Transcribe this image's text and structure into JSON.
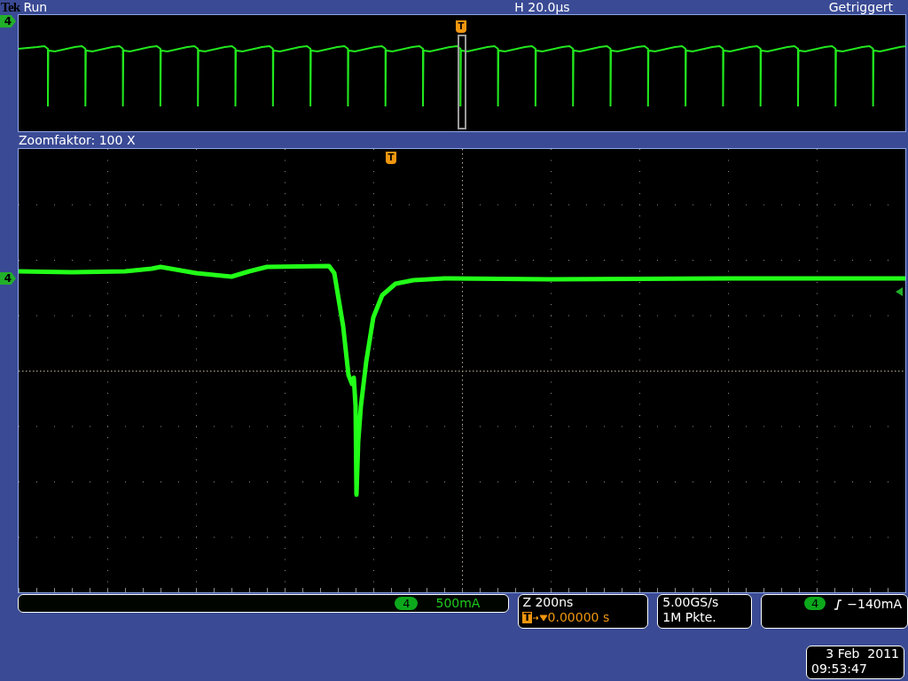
{
  "header": {
    "brand": "Tek",
    "status": "Run",
    "horizontal": "H 20.0µs",
    "trigger_state": "Getriggert"
  },
  "overview": {
    "channel_marker": "4",
    "trigger_marker": "T"
  },
  "zoom_label": "Zoomfaktor: 100 X",
  "main": {
    "channel_marker": "4",
    "trigger_marker": "T"
  },
  "channel_readout": {
    "channel": "4",
    "scale": "500mA"
  },
  "zoom_readout": {
    "timebase": "Z 200ns",
    "trigger_marker": "T",
    "position": "0.00000 s"
  },
  "acquisition": {
    "sample_rate": "5.00GS/s",
    "record_length": "1M Pkte."
  },
  "trigger_readout": {
    "channel": "4",
    "level": "−140mA"
  },
  "timestamp": {
    "date": "3 Feb  2011",
    "time": "09:53:47"
  }
}
